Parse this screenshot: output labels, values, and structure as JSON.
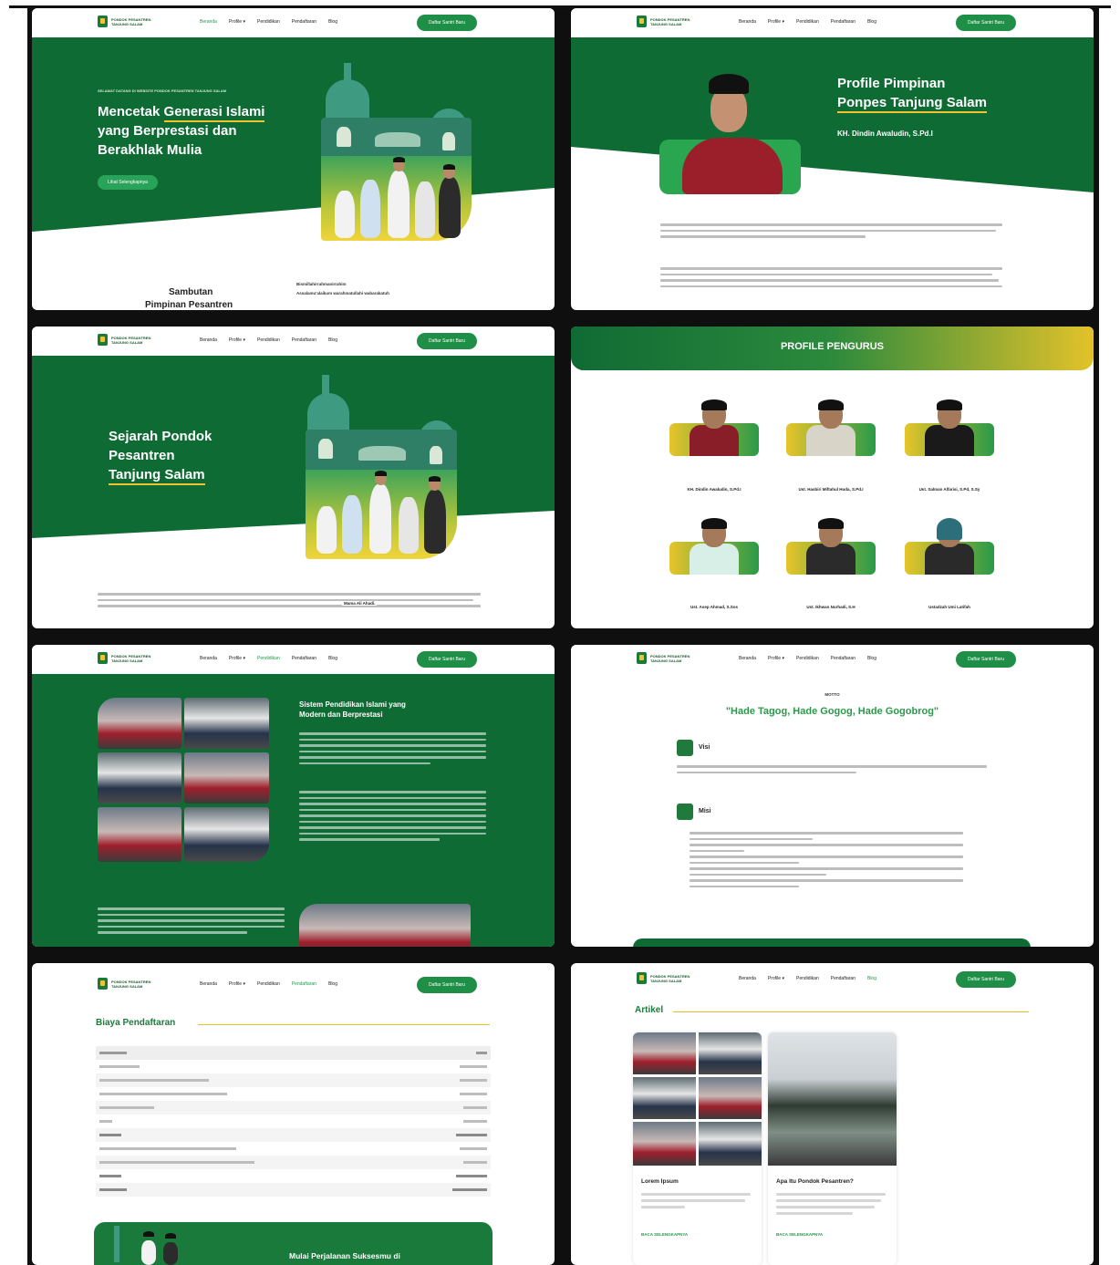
{
  "nav": {
    "brand_top": "PONDOK PESANTREN",
    "brand_name": "TANJUNG SALAM",
    "links": [
      "Beranda",
      "Profile ▾",
      "Pendidikan",
      "Pendaftaran",
      "Blog"
    ],
    "cta": "Daftar Santri Baru"
  },
  "panel1": {
    "kicker": "SELAMAT DATANG DI WEBSITE PONDOK PESANTREN TANJUNG SALAM",
    "title_1": "Mencetak",
    "title_highlight": "Generasi Islami",
    "title_2": "yang Berprestasi dan",
    "title_3": "Berakhlak Mulia",
    "button": "Lihat Selengkapnya",
    "sambutan_1": "Sambutan",
    "sambutan_2": "Pimpinan Pesantren",
    "salam_1": "Bismillahirrahmanirrahim",
    "salam_2": "Assalamu'alaikum warahmatullahi wabarakatuh"
  },
  "panel2": {
    "title_1": "Profile Pimpinan",
    "title_2": "Ponpes Tanjung Salam",
    "name": "KH. Dindin Awaludin, S.Pd.I"
  },
  "panel3": {
    "title_1": "Sejarah Pondok",
    "title_2": "Pesantren",
    "title_3": "Tanjung Salam",
    "body_highlight": "Mama Ali Ahadi."
  },
  "panel4": {
    "banner": "PROFILE PENGURUS",
    "people": [
      {
        "name": "KH. Dindin Awaludin, S.Pd.I",
        "robe": "#8a1e28"
      },
      {
        "name": "Ust. Hasbiri Miftahul Huda, S.Pd.I",
        "robe": "#d9d4c8"
      },
      {
        "name": "Ust. Salman Alfarisi, S.Pd, S.Sy",
        "robe": "#1a1a1a"
      },
      {
        "name": "Ust. Asep Ahmad, S.Sos",
        "robe": "#d7efe6"
      },
      {
        "name": "Ust. Ikhwan Nurhadi, S.H",
        "robe": "#2b2b2b"
      },
      {
        "name": "Ustadzah Umi Latifah",
        "robe": "#2a2a2a"
      }
    ]
  },
  "panel5": {
    "title_1": "Sistem Pendidikan Islami yang",
    "title_2": "Modern dan Berprestasi"
  },
  "panel6": {
    "kicker": "MOTTO",
    "motto": "\"Hade Tagog, Hade Gogog, Hade Gogobrog\"",
    "visi_label": "Visi",
    "misi_label": "Misi"
  },
  "panel7": {
    "title": "Biaya Pendaftaran",
    "cta_title": "Mulai Perjalanan Suksesmu di"
  },
  "panel8": {
    "title": "Artikel",
    "articles": [
      {
        "title": "Lorem Ipsum",
        "more": "BACA SELENGKAPNYA"
      },
      {
        "title": "Apa Itu Pondok Pesantren?",
        "more": "BACA SELENGKAPNYA"
      }
    ]
  },
  "colors": {
    "primary_green": "#0f6b34",
    "button_green": "#1f8f48",
    "accent_gold": "#f2c230",
    "background": "#ffffff"
  }
}
